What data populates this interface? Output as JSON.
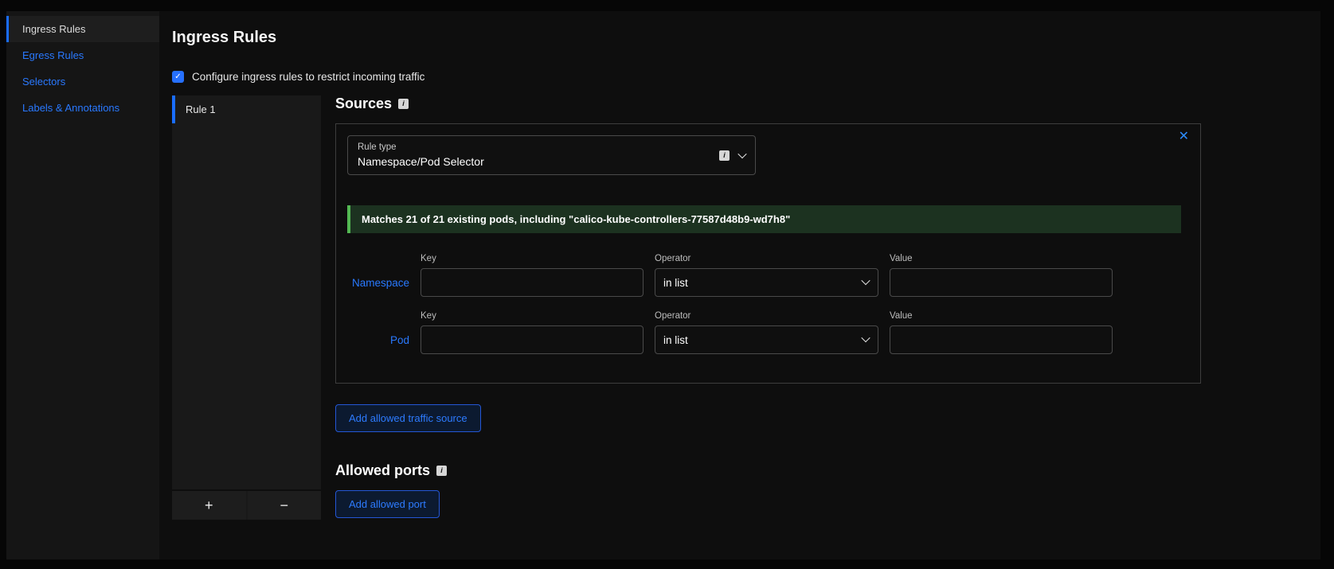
{
  "sidebar": {
    "items": [
      {
        "label": "Ingress Rules"
      },
      {
        "label": "Egress Rules"
      },
      {
        "label": "Selectors"
      },
      {
        "label": "Labels & Annotations"
      }
    ]
  },
  "icons": {
    "close": "✕",
    "check": "✓",
    "info": "i",
    "add": "+",
    "remove": "−"
  },
  "main": {
    "title": "Ingress Rules",
    "configure_label": "Configure ingress rules to restrict incoming traffic",
    "rules": {
      "items": [
        {
          "label": "Rule 1"
        }
      ]
    },
    "sources": {
      "heading": "Sources",
      "rule_type": {
        "label": "Rule type",
        "value": "Namespace/Pod Selector"
      },
      "match_banner": "Matches 21 of 21 existing pods, including \"calico-kube-controllers-77587d48b9-wd7h8\"",
      "selector_rows": [
        {
          "name": "Namespace",
          "key_label": "Key",
          "key_value": "",
          "operator_label": "Operator",
          "operator_value": "in list",
          "value_label": "Value",
          "value_value": ""
        },
        {
          "name": "Pod",
          "key_label": "Key",
          "key_value": "",
          "operator_label": "Operator",
          "operator_value": "in list",
          "value_label": "Value",
          "value_value": ""
        }
      ],
      "add_source_button": "Add allowed traffic source"
    },
    "ports": {
      "heading": "Allowed ports",
      "add_port_button": "Add allowed port"
    }
  },
  "colors": {
    "accent_blue": "#2979ff",
    "success_green": "#53b853"
  }
}
